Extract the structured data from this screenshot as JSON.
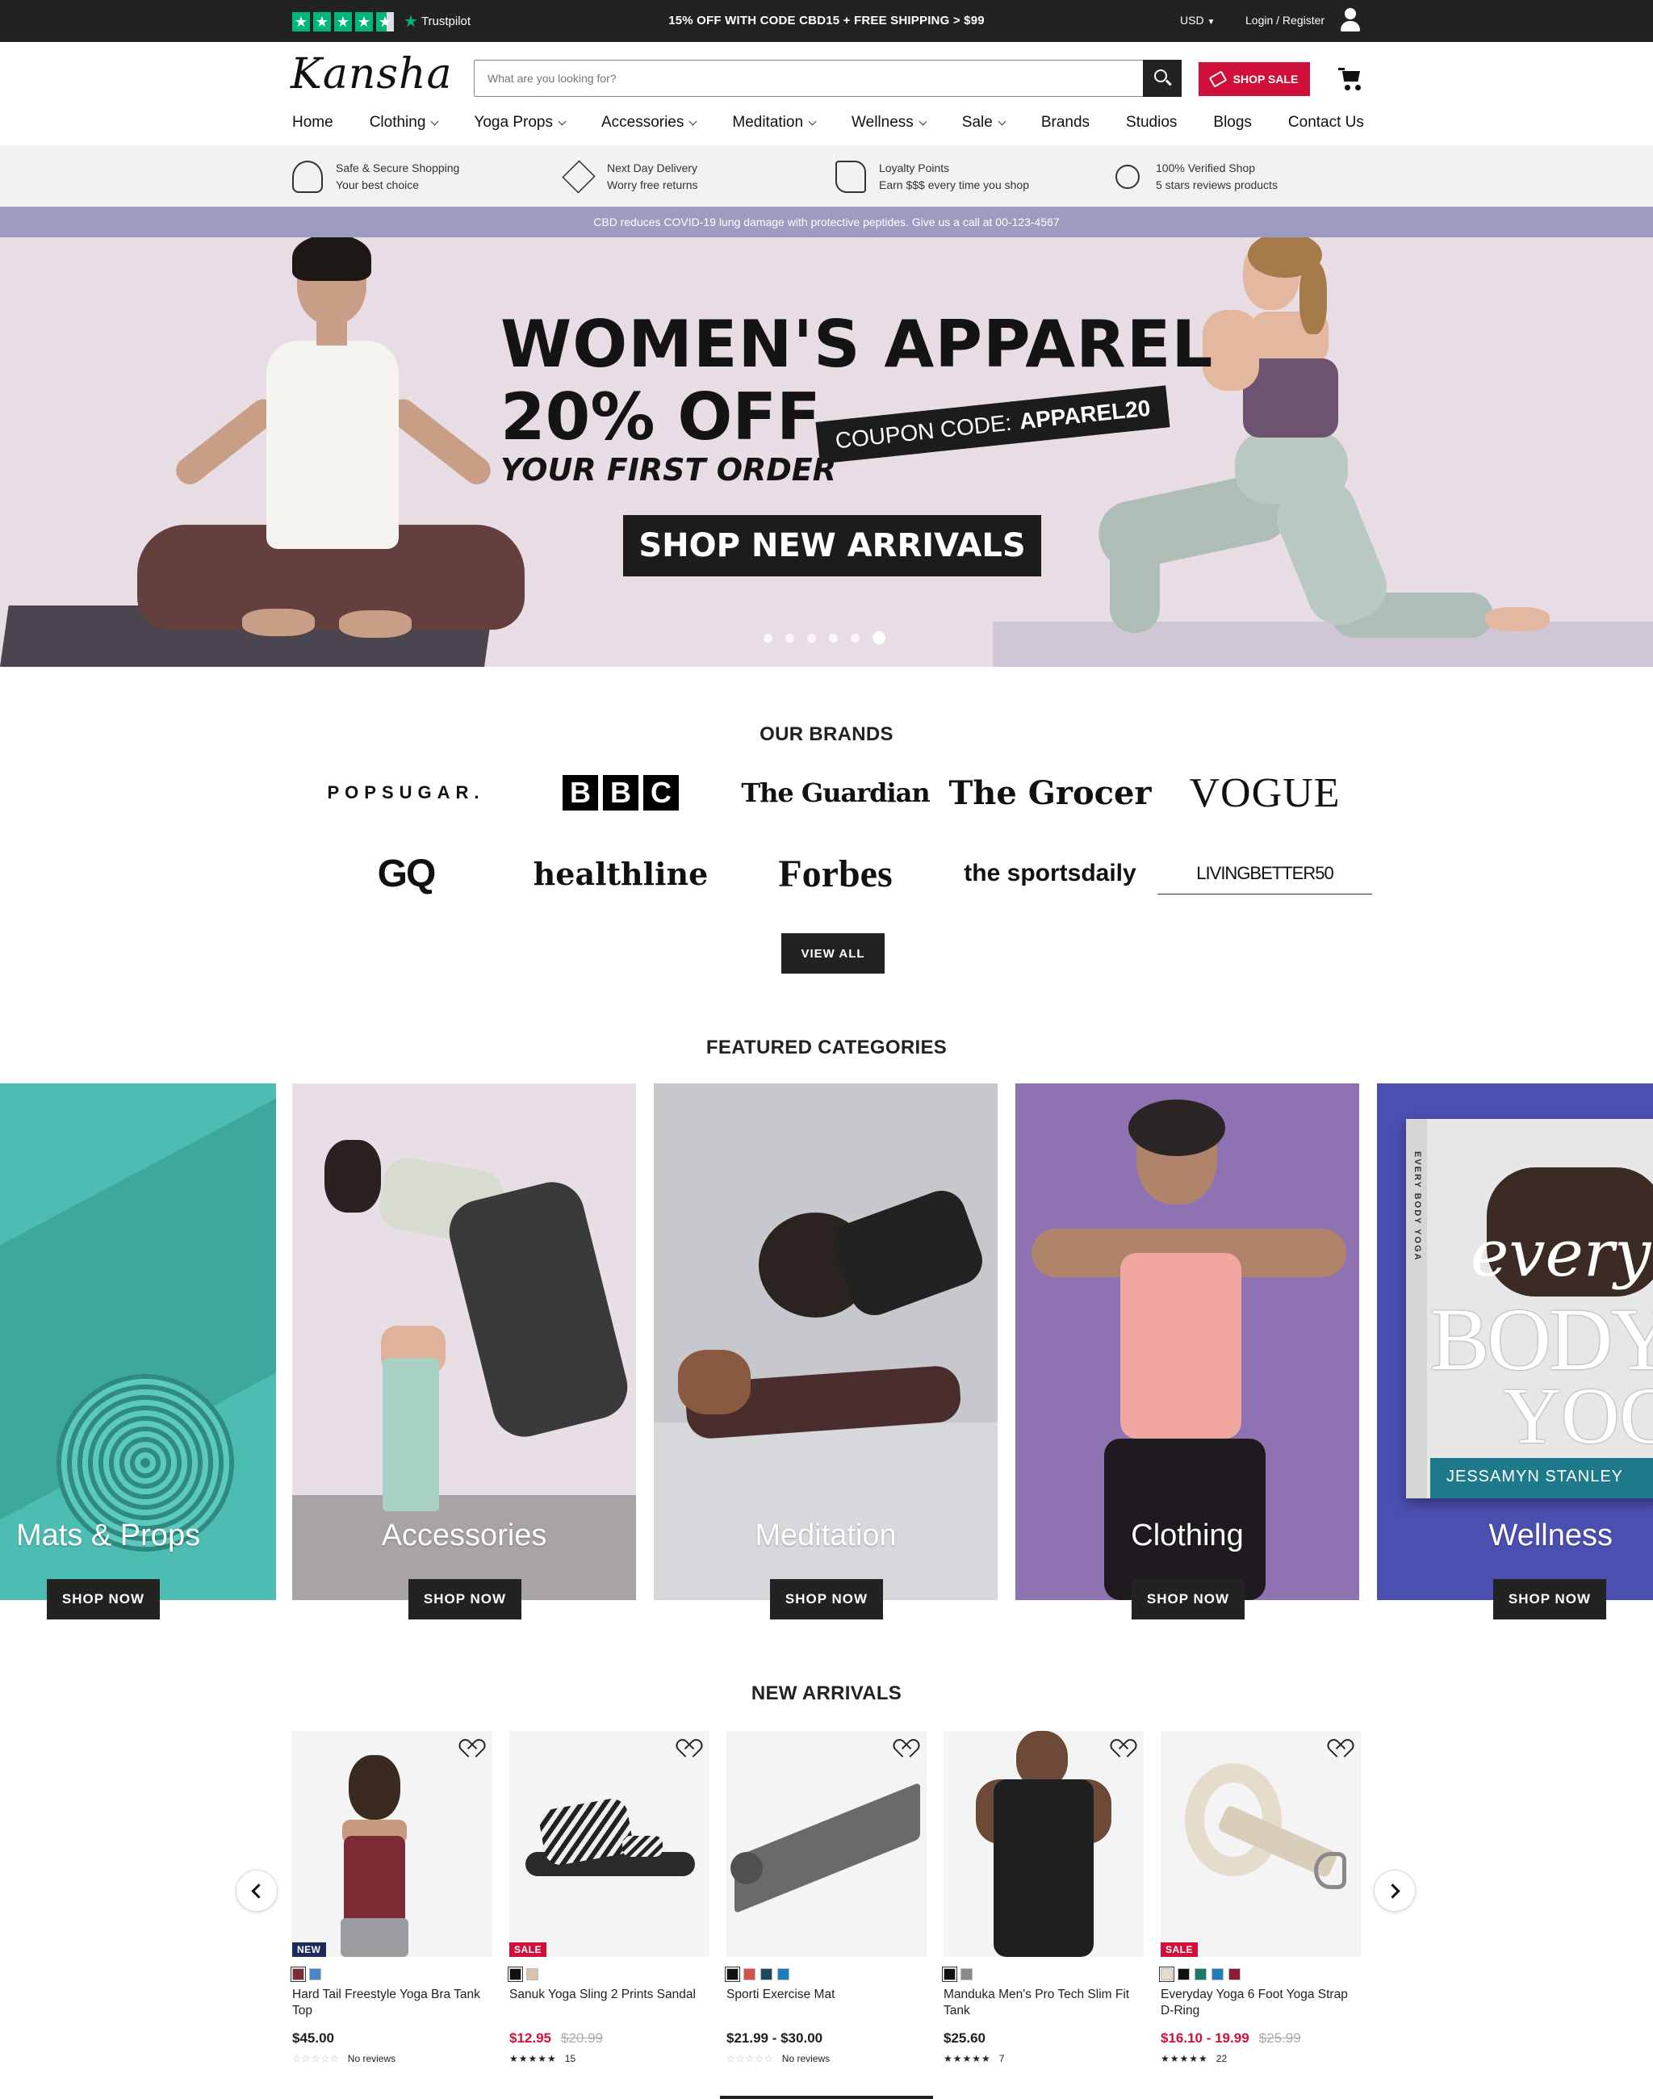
{
  "topbar": {
    "trustpilot_label": "Trustpilot",
    "trustpilot_rating": 4.5,
    "promo": "15% OFF WITH CODE CBD15 + FREE SHIPPING > $99",
    "currency": "USD",
    "login": "Login / Register"
  },
  "header": {
    "logo": "Kansha",
    "search_placeholder": "What are you looking for?",
    "shop_sale": "SHOP SALE"
  },
  "nav": [
    {
      "label": "Home",
      "dropdown": false
    },
    {
      "label": "Clothing",
      "dropdown": true
    },
    {
      "label": "Yoga Props",
      "dropdown": true
    },
    {
      "label": "Accessories",
      "dropdown": true
    },
    {
      "label": "Meditation",
      "dropdown": true
    },
    {
      "label": "Wellness",
      "dropdown": true
    },
    {
      "label": "Sale",
      "dropdown": true
    },
    {
      "label": "Brands",
      "dropdown": false
    },
    {
      "label": "Studios",
      "dropdown": false
    },
    {
      "label": "Blogs",
      "dropdown": false
    },
    {
      "label": "Contact Us",
      "dropdown": false
    }
  ],
  "features": [
    {
      "icon": "shield-user-icon",
      "title": "Safe & Secure Shopping",
      "sub": "Your best choice"
    },
    {
      "icon": "box-icon",
      "title": "Next Day Delivery",
      "sub": "Worry free returns"
    },
    {
      "icon": "handshake-icon",
      "title": "Loyalty Points",
      "sub": "Earn $$$ every time you shop"
    },
    {
      "icon": "award-icon",
      "title": "100% Verified Shop",
      "sub": "5 stars reviews products"
    }
  ],
  "announcement": "CBD reduces COVID-19 lung damage with protective peptides. Give us a call at 00-123-4567",
  "hero": {
    "title": "WOMEN'S APPAREL",
    "discount": "20% OFF",
    "subtitle": "YOUR FIRST ORDER",
    "coupon_label": "COUPON CODE:",
    "coupon_code": "APPAREL20",
    "cta": "SHOP NEW ARRIVALS",
    "slides": 6,
    "active_slide": 6
  },
  "brands": {
    "title": "OUR BRANDS",
    "items": [
      "POPSUGAR.",
      "BBC",
      "The Guardian",
      "The Grocer",
      "VOGUE",
      "GQ",
      "healthline",
      "Forbes",
      "the sportsdaily",
      "LIVINGBETTER50"
    ],
    "view_all": "VIEW ALL"
  },
  "categories": {
    "title": "FEATURED CATEGORIES",
    "button": "SHOP NOW",
    "items": [
      {
        "label": "Mats & Props",
        "bg": "#4dbdb3"
      },
      {
        "label": "Accessories",
        "bg": "#e8dee5"
      },
      {
        "label": "Meditation",
        "bg": "#c7c8cd"
      },
      {
        "label": "Clothing",
        "bg": "#8e72b2"
      },
      {
        "label": "Wellness",
        "bg": "#4b4fb0"
      }
    ],
    "book": {
      "title1": "every",
      "title2": "BODY",
      "title3": "YOGA",
      "author": "JESSAMYN STANLEY",
      "spine": "EVERY BODY YOGA"
    }
  },
  "arrivals": {
    "title": "NEW ARRIVALS",
    "products": [
      {
        "name": "Hard Tail Freestyle Yoga Bra Tank Top",
        "price": "$45.00",
        "sale_price": "",
        "was_price": "",
        "badge": "NEW",
        "badge_color": "#1e2a5a",
        "swatches": [
          "#7b2b34",
          "#4a86c5"
        ],
        "rating": 0,
        "reviews": "No reviews"
      },
      {
        "name": "Sanuk Yoga Sling 2 Prints Sandal",
        "price": "",
        "sale_price": "$12.95",
        "was_price": "$20.99",
        "badge": "SALE",
        "badge_color": "#d0103a",
        "swatches": [
          "#111111",
          "#d9c3ad"
        ],
        "rating": 5,
        "reviews": "15"
      },
      {
        "name": "Sporti Exercise Mat",
        "price": "$21.99 - $30.00",
        "sale_price": "",
        "was_price": "",
        "badge": "",
        "badge_color": "",
        "swatches": [
          "#111111",
          "#d3524a",
          "#1c4a5c",
          "#1e7fb8"
        ],
        "rating": 0,
        "reviews": "No reviews"
      },
      {
        "name": "Manduka Men's Pro Tech Slim Fit Tank",
        "price": "$25.60",
        "sale_price": "",
        "was_price": "",
        "badge": "",
        "badge_color": "",
        "swatches": [
          "#111111",
          "#8a8a8a"
        ],
        "rating": 5,
        "reviews": "7"
      },
      {
        "name": "Everyday Yoga 6 Foot Yoga Strap D-Ring",
        "price": "",
        "sale_price": "$16.10 - 19.99",
        "was_price": "$25.99",
        "badge": "SALE",
        "badge_color": "#d0103a",
        "swatches": [
          "#e6dccb",
          "#111111",
          "#1a7a6a",
          "#1e7fb8",
          "#8a1d36"
        ],
        "rating": 5,
        "reviews": "22"
      }
    ]
  }
}
